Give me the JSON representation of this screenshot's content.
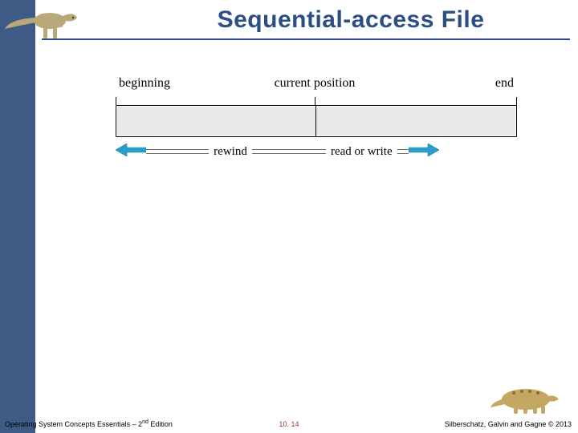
{
  "title": "Sequential-access File",
  "diagram": {
    "labels": {
      "beginning": "beginning",
      "current": "current position",
      "end": "end"
    },
    "ops": {
      "rewind": "rewind",
      "readwrite": "read or write"
    },
    "current_fraction": 0.496
  },
  "footer": {
    "left_pre": "Operating System Concepts Essentials – 2",
    "left_sup": "nd",
    "left_post": " Edition",
    "page": "10. 14",
    "right": "Silberschatz, Galvin and Gagne © 2013"
  },
  "colors": {
    "accent": "#2b4f84",
    "arrow": "#2aa0c8"
  },
  "icons": {
    "top_dino": "theropod-dino-icon",
    "bottom_dino": "ankylosaur-dino-icon"
  }
}
